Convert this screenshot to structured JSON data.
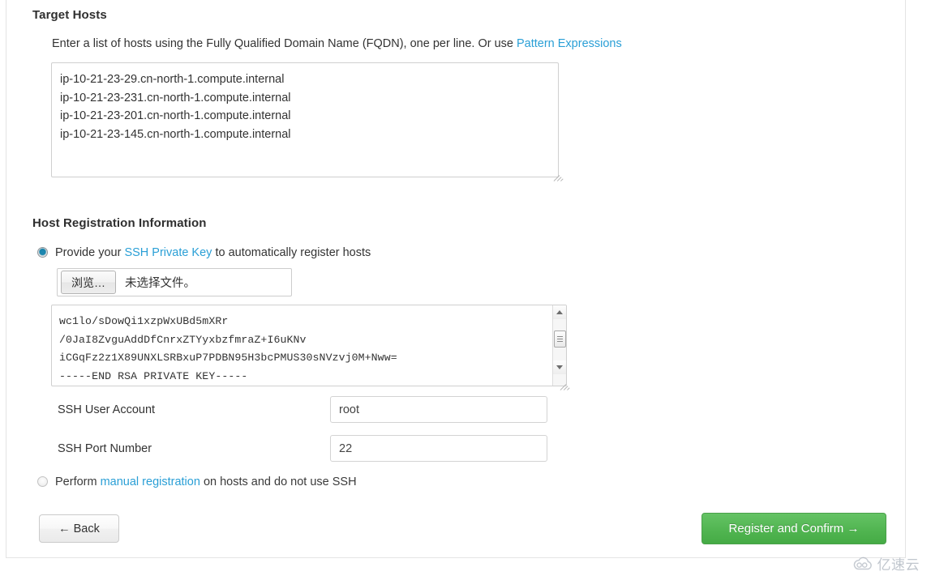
{
  "target_hosts": {
    "title": "Target Hosts",
    "helper_prefix": "Enter a list of hosts using the Fully Qualified Domain Name (FQDN), one per line. Or use ",
    "helper_link": "Pattern Expressions",
    "hosts_value": "ip-10-21-23-29.cn-north-1.compute.internal\nip-10-21-23-231.cn-north-1.compute.internal\nip-10-21-23-201.cn-north-1.compute.internal\nip-10-21-23-145.cn-north-1.compute.internal",
    "hosts_placeholder": ""
  },
  "host_registration": {
    "title": "Host Registration Information",
    "ssh_option": {
      "prefix": "Provide your ",
      "link": "SSH Private Key",
      "suffix": " to automatically register hosts",
      "selected": true
    },
    "file_input": {
      "browse_label": "浏览…",
      "file_name": "未选择文件。"
    },
    "private_key_value": "wc1lo/sDowQi1xzpWxUBd5mXRr\n/0JaI8ZvguAddDfCnrxZTYyxbzfmraZ+I6uKNv\niCGqFz2z1X89UNXLSRBxuP7PDBN95H3bcPMUS30sNVzvj0M+Nww=\n-----END RSA PRIVATE KEY-----",
    "ssh_user": {
      "label": "SSH User Account",
      "value": "root"
    },
    "ssh_port": {
      "label": "SSH Port Number",
      "value": "22"
    },
    "manual_option": {
      "prefix": "Perform ",
      "link": "manual registration",
      "suffix": " on hosts and do not use SSH",
      "selected": false
    }
  },
  "footer": {
    "back_label": "← Back",
    "register_label": "Register and Confirm →"
  },
  "watermark": {
    "text": "亿速云"
  },
  "colors": {
    "link": "#2a9fd6",
    "primary_button": "#51b551",
    "radio_selected": "#1d87b0"
  }
}
